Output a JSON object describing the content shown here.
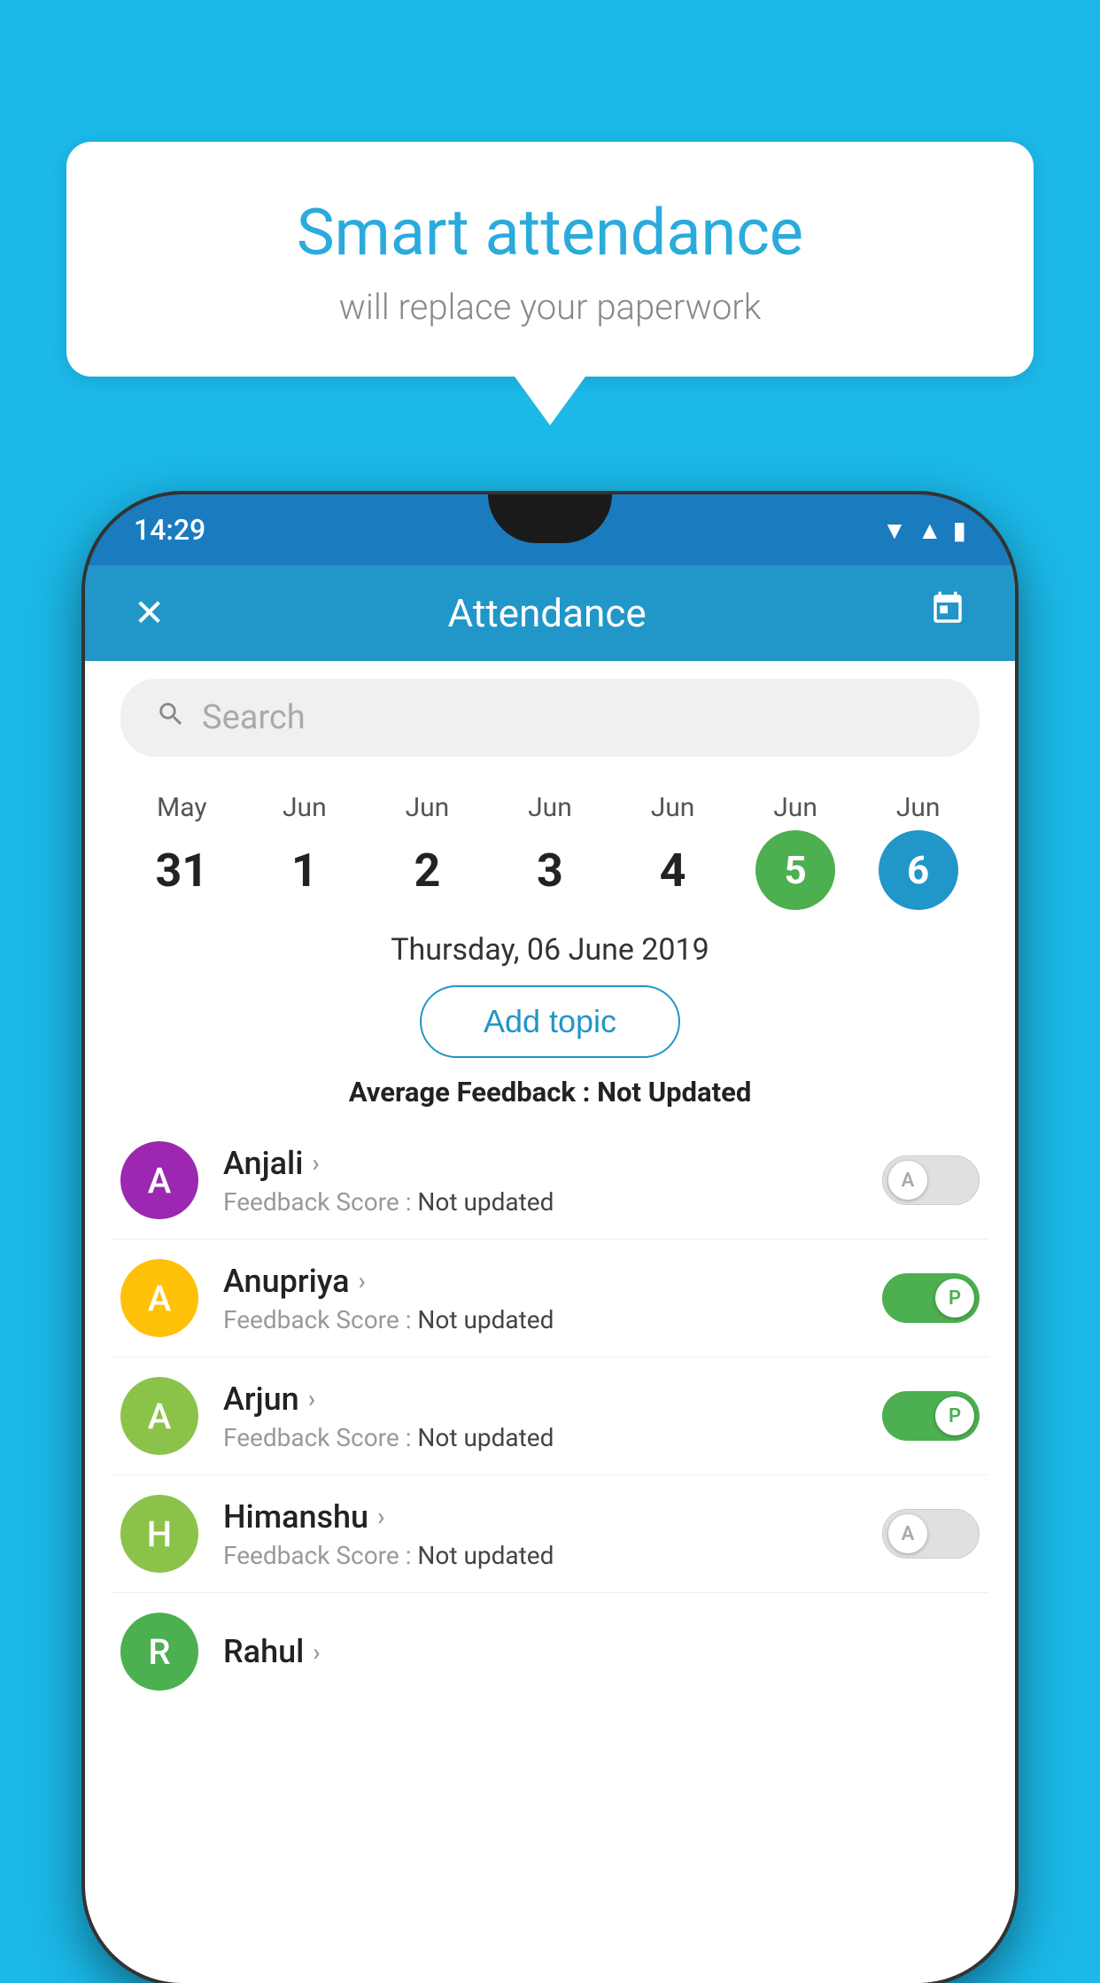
{
  "background_color": "#1BB8E8",
  "speech_bubble": {
    "title": "Smart attendance",
    "subtitle": "will replace your paperwork"
  },
  "phone": {
    "status_bar": {
      "time": "14:29",
      "icons": [
        "wifi",
        "signal",
        "battery"
      ]
    },
    "header": {
      "close_label": "✕",
      "title": "Attendance",
      "calendar_icon": "📅"
    },
    "search": {
      "placeholder": "Search"
    },
    "dates": [
      {
        "month": "May",
        "day": "31",
        "state": "normal"
      },
      {
        "month": "Jun",
        "day": "1",
        "state": "normal"
      },
      {
        "month": "Jun",
        "day": "2",
        "state": "normal"
      },
      {
        "month": "Jun",
        "day": "3",
        "state": "normal"
      },
      {
        "month": "Jun",
        "day": "4",
        "state": "normal"
      },
      {
        "month": "Jun",
        "day": "5",
        "state": "today"
      },
      {
        "month": "Jun",
        "day": "6",
        "state": "selected"
      }
    ],
    "selected_date_label": "Thursday, 06 June 2019",
    "add_topic_label": "Add topic",
    "avg_feedback_label": "Average Feedback :",
    "avg_feedback_value": "Not Updated",
    "students": [
      {
        "name": "Anjali",
        "feedback_label": "Feedback Score :",
        "feedback_value": "Not updated",
        "avatar_letter": "A",
        "avatar_color": "#9C27B0",
        "toggle_state": "off",
        "toggle_letter": "A"
      },
      {
        "name": "Anupriya",
        "feedback_label": "Feedback Score :",
        "feedback_value": "Not updated",
        "avatar_letter": "A",
        "avatar_color": "#FFC107",
        "toggle_state": "on",
        "toggle_letter": "P"
      },
      {
        "name": "Arjun",
        "feedback_label": "Feedback Score :",
        "feedback_value": "Not updated",
        "avatar_letter": "A",
        "avatar_color": "#8BC34A",
        "toggle_state": "on",
        "toggle_letter": "P"
      },
      {
        "name": "Himanshu",
        "feedback_label": "Feedback Score :",
        "feedback_value": "Not updated",
        "avatar_letter": "H",
        "avatar_color": "#8BC34A",
        "toggle_state": "off",
        "toggle_letter": "A"
      }
    ]
  }
}
